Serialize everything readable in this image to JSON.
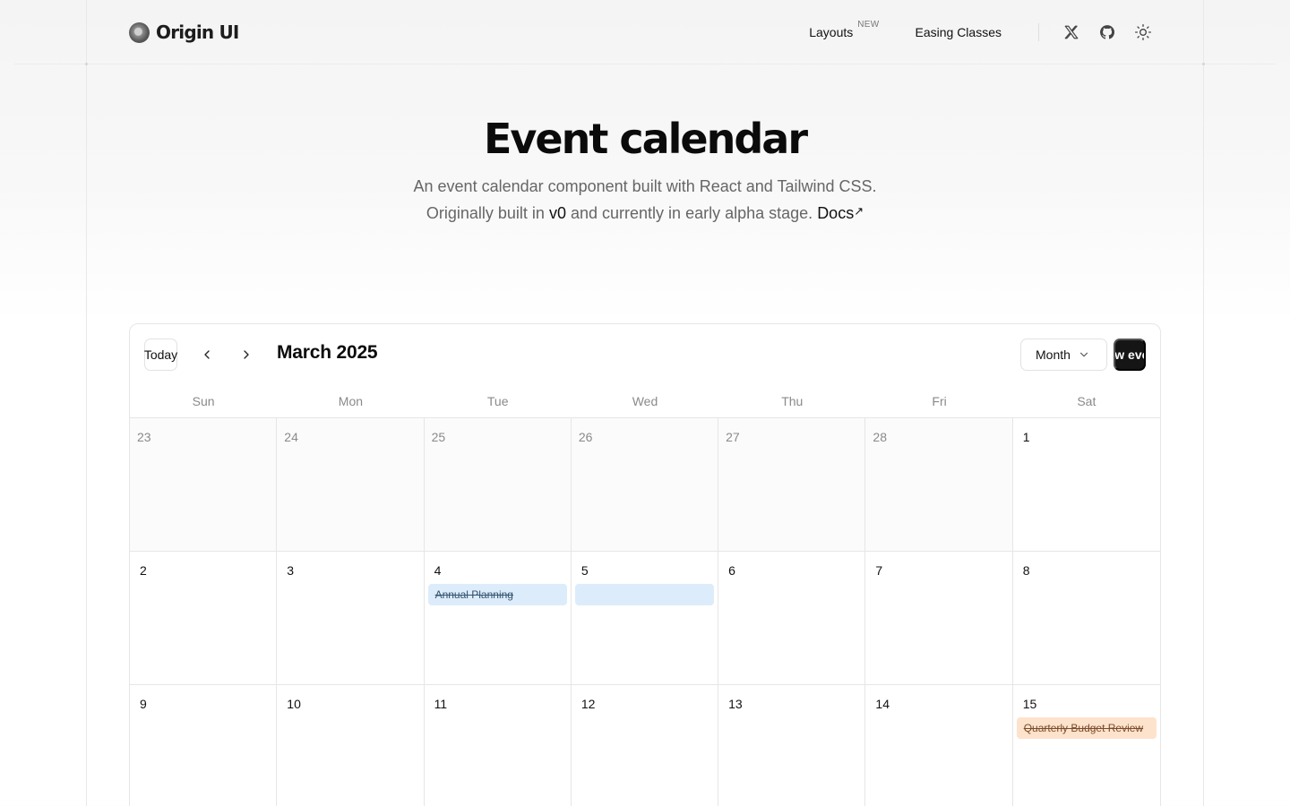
{
  "header": {
    "logo_text": "Origin UI",
    "nav": [
      {
        "label": "Layouts",
        "badge": "NEW"
      },
      {
        "label": "Easing Classes",
        "badge": ""
      }
    ],
    "icons": [
      "x-logo-icon",
      "github-icon",
      "sun-icon"
    ]
  },
  "hero": {
    "title": "Event calendar",
    "line1": "An event calendar component built with React and Tailwind CSS.",
    "line2_pre": "Originally built in",
    "line2_v0": "v0",
    "line2_post": "and currently in early alpha stage.",
    "docs_label": "Docs",
    "docs_arrow": "↗"
  },
  "calendar": {
    "today_label": "Today",
    "month_label": "March 2025",
    "view_label": "Month",
    "new_event_label": "New event",
    "weekdays": [
      "Sun",
      "Mon",
      "Tue",
      "Wed",
      "Thu",
      "Fri",
      "Sat"
    ],
    "weeks": [
      [
        {
          "day": "23",
          "outside": true
        },
        {
          "day": "24",
          "outside": true
        },
        {
          "day": "25",
          "outside": true
        },
        {
          "day": "26",
          "outside": true
        },
        {
          "day": "27",
          "outside": true
        },
        {
          "day": "28",
          "outside": true
        },
        {
          "day": "1",
          "outside": false
        }
      ],
      [
        {
          "day": "2",
          "outside": false
        },
        {
          "day": "3",
          "outside": false
        },
        {
          "day": "4",
          "outside": false,
          "event": {
            "title": "Annual Planning",
            "color": "sky"
          }
        },
        {
          "day": "5",
          "outside": false,
          "event": {
            "title": "",
            "color": "sky"
          }
        },
        {
          "day": "6",
          "outside": false
        },
        {
          "day": "7",
          "outside": false
        },
        {
          "day": "8",
          "outside": false
        }
      ],
      [
        {
          "day": "9",
          "outside": false
        },
        {
          "day": "10",
          "outside": false
        },
        {
          "day": "11",
          "outside": false
        },
        {
          "day": "12",
          "outside": false
        },
        {
          "day": "13",
          "outside": false
        },
        {
          "day": "14",
          "outside": false
        },
        {
          "day": "15",
          "outside": false,
          "event": {
            "title": "Quarterly Budget Review",
            "color": "orange"
          }
        }
      ]
    ]
  }
}
